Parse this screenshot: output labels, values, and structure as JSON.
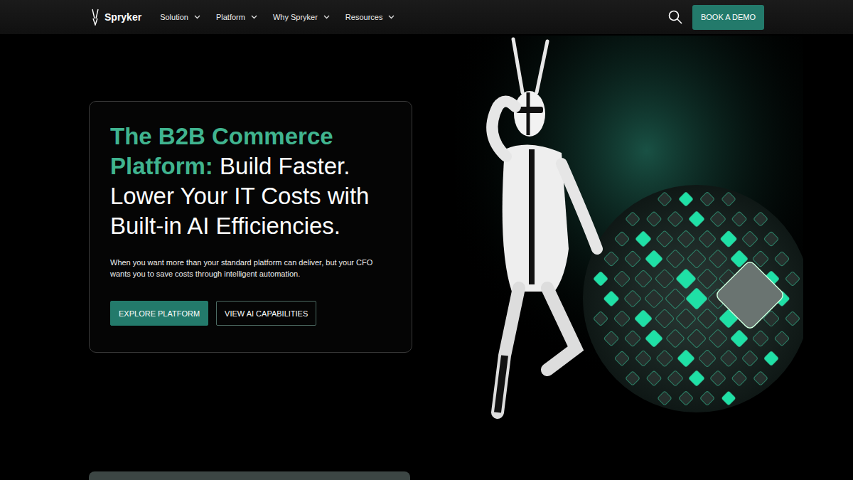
{
  "nav": {
    "logo": "Spryker",
    "items": [
      {
        "label": "Solution",
        "expanded": false
      },
      {
        "label": "Platform",
        "expanded": false
      },
      {
        "label": "Why Spryker",
        "expanded": false
      },
      {
        "label": "Resources",
        "expanded": false
      }
    ],
    "cta": "BOOK A DEMO"
  },
  "hero": {
    "heading_highlight": "The B2B Commerce Platform:",
    "heading": "Build Faster. Lower Your IT Costs with Built-in AI Efficiencies.",
    "subtext": "When you want more than your standard platform can deliver, but your CFO wants you to save costs through intelligent automation.",
    "buttons": [
      {
        "label": "EXPLORE PLATFORM",
        "kind": "primary"
      },
      {
        "label": "VIEW AI CAPABILITIES",
        "kind": "outline"
      }
    ]
  }
}
